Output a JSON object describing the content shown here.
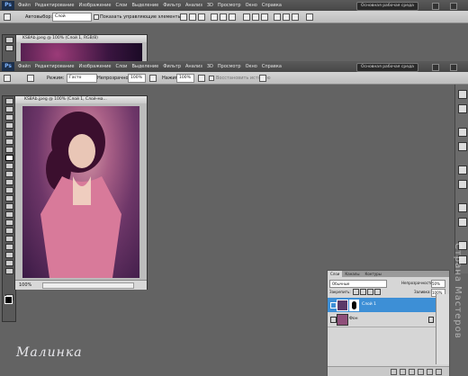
{
  "menubar": {
    "app_badge": "Ps",
    "items": [
      "Файл",
      "Редактирование",
      "Изображение",
      "Слои",
      "Выделение",
      "Фильтр",
      "Анализ",
      "3D",
      "Просмотр",
      "Окно",
      "Справка"
    ],
    "workspace_label": "Основная рабочая среда",
    "zoom": "100%"
  },
  "options_top": {
    "autoselect_label": "Автовыбор:",
    "autoselect_value": "Слой",
    "show_controls_label": "Показать управляющие элементы"
  },
  "options_brush": {
    "mode_label": "Режим:",
    "mode_value": "Гасто",
    "opacity_label": "Непрозрачность:",
    "opacity_value": "100%",
    "flow_label": "Нажим:",
    "flow_value": "100%",
    "history_label": "Восстановить историю"
  },
  "documents": [
    {
      "title": "KS8Ab.jpeg @ 100% (Слой 1, RGB/8)"
    },
    {
      "title": "KS8Ab.jpeg @ 100% (Слой 1, Слой-ма...",
      "zoom_status": "100%"
    }
  ],
  "layers_panel": {
    "tabs": [
      "Слои",
      "Каналы",
      "Контуры"
    ],
    "blend_mode": "Обычные",
    "opacity_label": "Непрозрачность:",
    "opacity_value": "50%",
    "lock_label": "Закрепить:",
    "fill_label": "Заливка:",
    "fill_value": "100%",
    "layers": [
      {
        "name": "Слой 1",
        "selected": true
      },
      {
        "name": "Фон",
        "selected": false
      }
    ]
  },
  "watermark": "Страна Мастеров",
  "signature": "Малинка",
  "colors": {
    "accent": "#3d8fd6",
    "background": "#636363"
  }
}
